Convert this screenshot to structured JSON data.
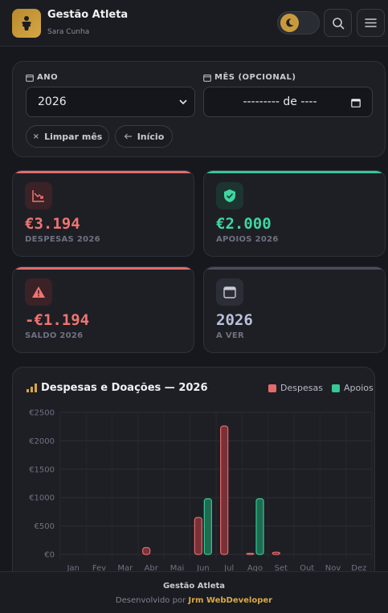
{
  "header": {
    "title": "Gestão Atleta",
    "user": "Sara Cunha",
    "logo_icon": "athlete-icon",
    "theme_icon": "moon-icon",
    "search_icon": "search-icon",
    "menu_icon": "menu-icon"
  },
  "filters": {
    "year_label": "ANO",
    "year_value": "2026",
    "month_label": "MÊS (OPCIONAL)",
    "month_value": "--------- de ----",
    "clear_month_label": "Limpar mês",
    "home_label": "Início"
  },
  "stats": {
    "despesas": {
      "value": "€3.194",
      "label": "DESPESAS 2026",
      "color": "#f07470"
    },
    "apoios": {
      "value": "€2.000",
      "label": "APOIOS 2026",
      "color": "#3fd6a0"
    },
    "saldo": {
      "value": "-€1.194",
      "label": "SALDO 2026",
      "color": "#f07470"
    },
    "ano": {
      "value": "2026",
      "label": "A VER",
      "color": "#b9c2da"
    }
  },
  "chart_data": {
    "type": "bar",
    "title": "Despesas e Doações — 2026",
    "categories": [
      "Jan",
      "Fev",
      "Mar",
      "Abr",
      "Mai",
      "Jun",
      "Jul",
      "Ago",
      "Set",
      "Out",
      "Nov",
      "Dez"
    ],
    "series": [
      {
        "name": "Despesas",
        "color": "#e56b6b",
        "values": [
          0,
          0,
          0,
          120,
          0,
          650,
          2260,
          20,
          40,
          0,
          0,
          0
        ]
      },
      {
        "name": "Apoios",
        "color": "#34c995",
        "values": [
          0,
          0,
          0,
          0,
          0,
          980,
          0,
          980,
          0,
          0,
          0,
          0
        ]
      }
    ],
    "yticks": [
      "€0",
      "€500",
      "€1000",
      "€1500",
      "€2000",
      "€2500"
    ],
    "ylim": [
      0,
      2500
    ],
    "grid": true,
    "legend": "top-right"
  },
  "footer": {
    "title": "Gestão Atleta",
    "credit_prefix": "Desenvolvido por",
    "credit_name": "Jrm WebDeveloper"
  }
}
